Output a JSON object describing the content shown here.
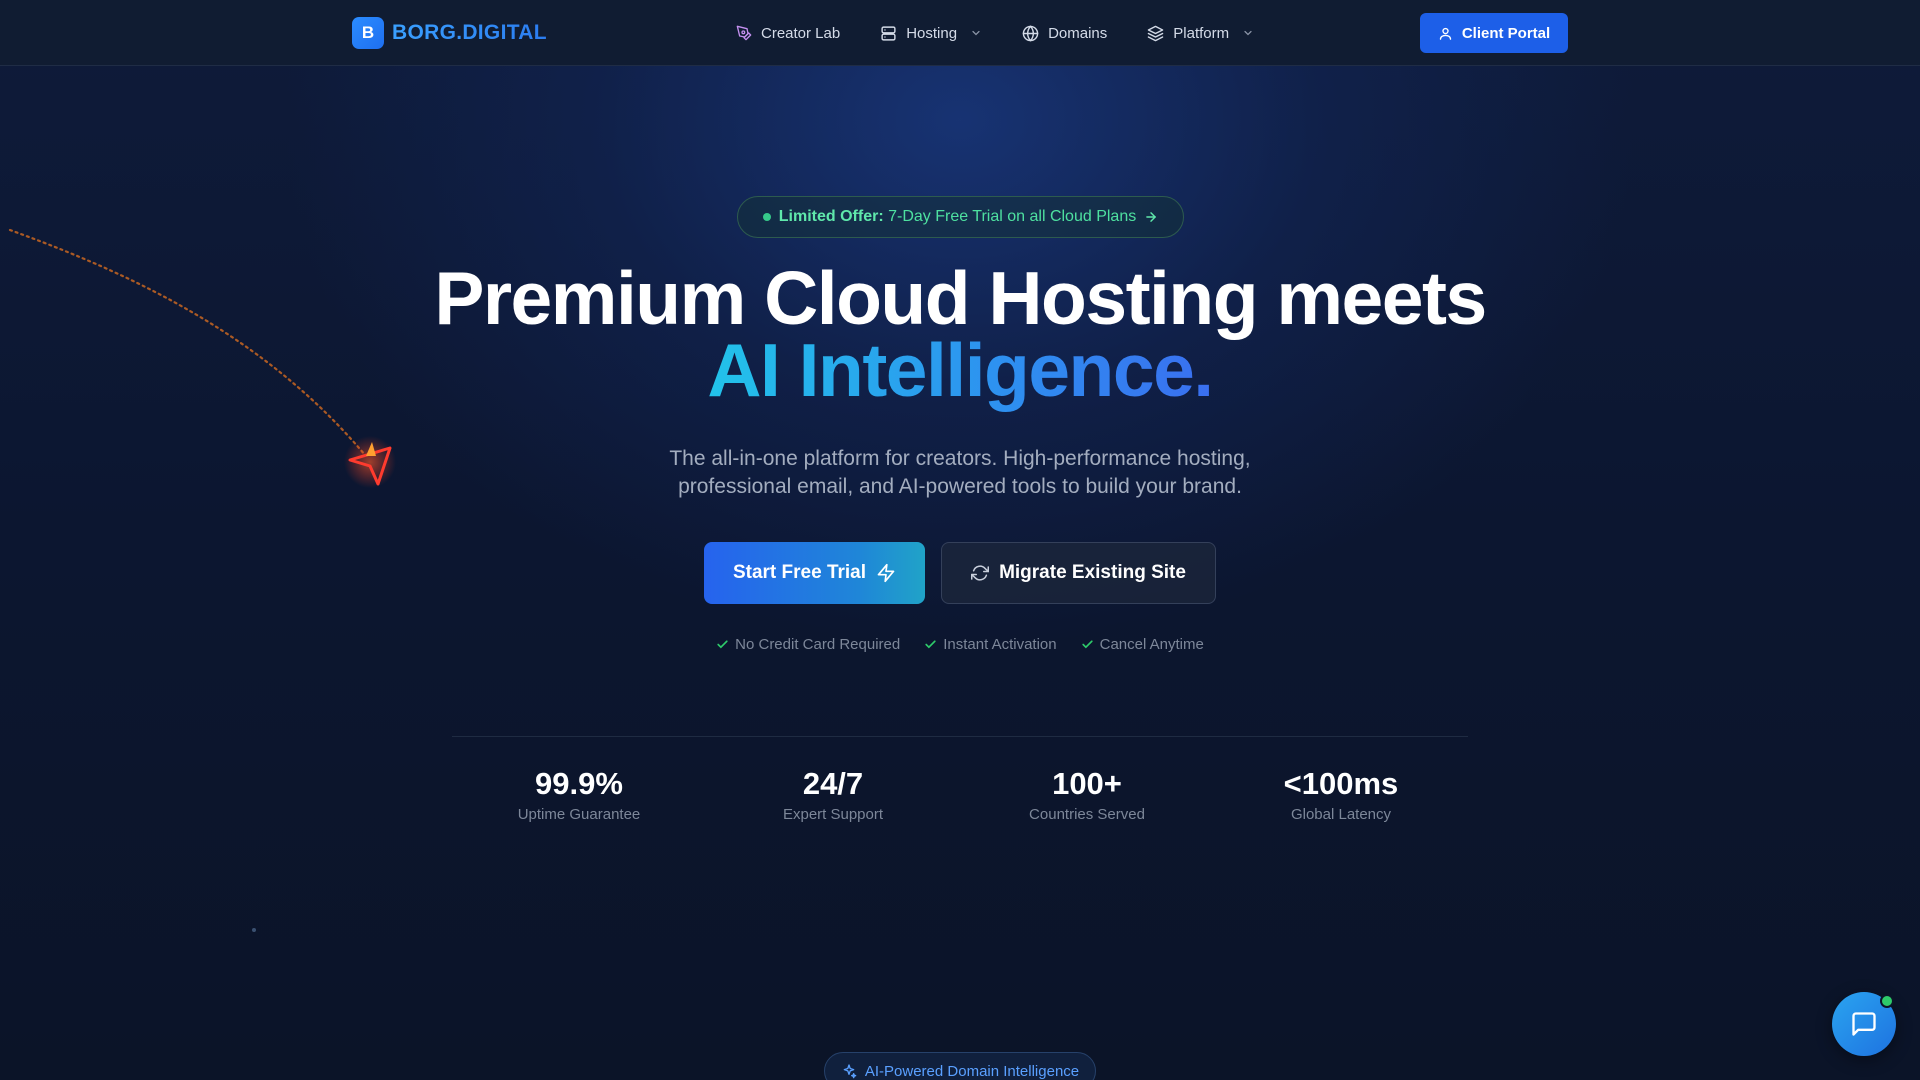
{
  "brand": {
    "badge_letter": "B",
    "name": "BORG.DIGITAL",
    "accent": "#2b8cff"
  },
  "nav": {
    "items": [
      {
        "label": "Creator Lab",
        "icon": "pen-tool-icon"
      },
      {
        "label": "Hosting",
        "icon": "server-icon",
        "dropdown": true
      },
      {
        "label": "Domains",
        "icon": "globe-icon"
      },
      {
        "label": "Platform",
        "icon": "layers-icon",
        "dropdown": true
      }
    ],
    "portal_button": "Client Portal"
  },
  "offer": {
    "strong": "Limited Offer:",
    "text": "7-Day Free Trial on all Cloud Plans",
    "color": "#4ee0a0"
  },
  "headline": {
    "line1": "Premium Cloud Hosting meets",
    "line2": "AI Intelligence."
  },
  "subtitle": {
    "line1": "The all-in-one platform for creators. High-performance hosting,",
    "line2": "professional email, and AI-powered tools to build your brand."
  },
  "cta": {
    "primary": "Start Free Trial",
    "secondary": "Migrate Existing Site"
  },
  "perks": [
    "No Credit Card Required",
    "Instant Activation",
    "Cancel Anytime"
  ],
  "stats": [
    {
      "value": "99.9%",
      "label": "Uptime Guarantee"
    },
    {
      "value": "24/7",
      "label": "Expert Support"
    },
    {
      "value": "100+",
      "label": "Countries Served"
    },
    {
      "value": "<100ms",
      "label": "Global Latency"
    }
  ],
  "ai_section_badge": "AI-Powered Domain Intelligence",
  "colors": {
    "background": "#0c1528",
    "primary_button": "#2663ee",
    "success": "#2ecb6a"
  }
}
